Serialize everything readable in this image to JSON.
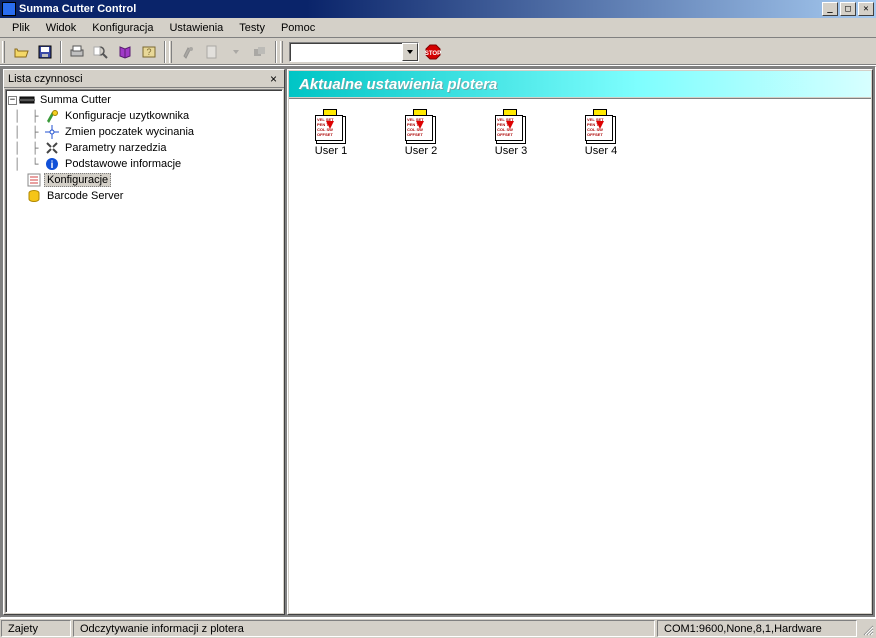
{
  "window": {
    "title": "Summa Cutter Control"
  },
  "menu": {
    "items": [
      "Plik",
      "Widok",
      "Konfiguracja",
      "Ustawienia",
      "Testy",
      "Pomoc"
    ]
  },
  "leftPanel": {
    "title": "Lista czynnosci",
    "tree": {
      "root": "Summa Cutter",
      "children": [
        "Konfiguracje uzytkownika",
        "Zmien poczatek wycinania",
        "Parametry narzedzia",
        "Podstawowe informacje"
      ],
      "siblings": [
        "Konfiguracje",
        "Barcode Server"
      ],
      "selected": "Konfiguracje"
    }
  },
  "rightPanel": {
    "header": "Aktualne ustawienia plotera",
    "users": [
      "User 1",
      "User 2",
      "User 3",
      "User 4"
    ]
  },
  "statusbar": {
    "state": "Zajety",
    "message": "Odczytywanie informacji z plotera",
    "port": "COM1:9600,None,8,1,Hardware"
  }
}
